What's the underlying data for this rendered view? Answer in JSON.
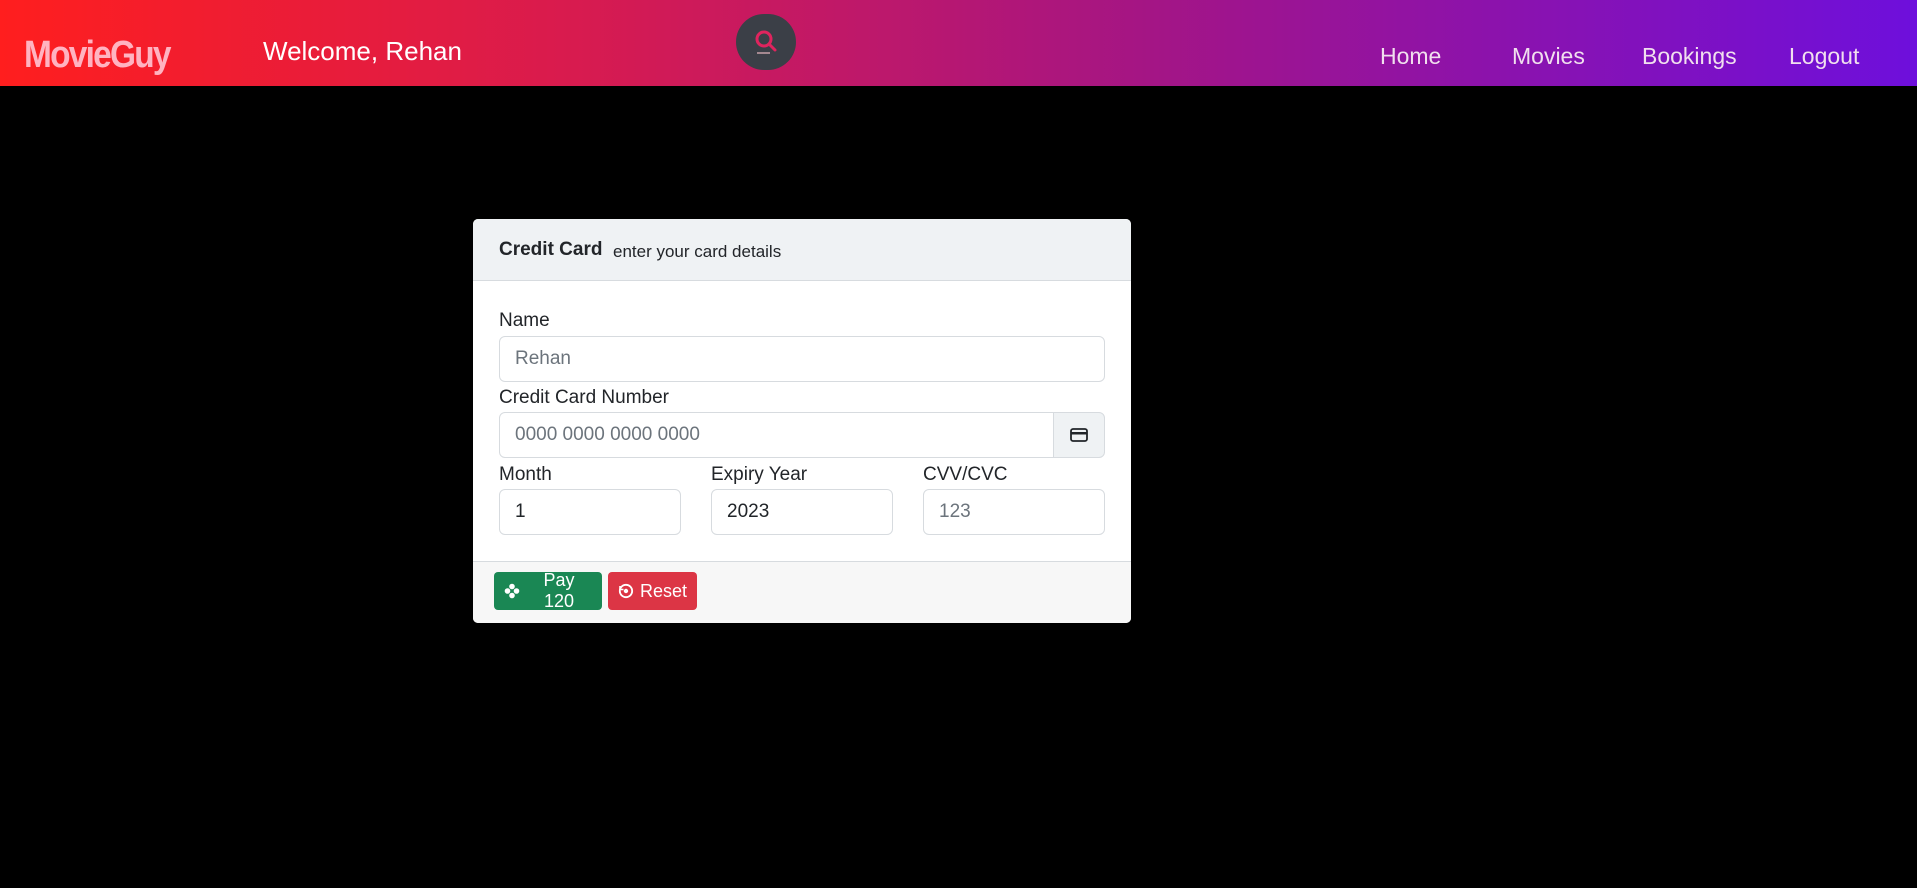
{
  "navbar": {
    "brand": "MovieGuy",
    "welcome_text": "Welcome, Rehan",
    "search_icon": "search-icon",
    "links": [
      {
        "label": "Home"
      },
      {
        "label": "Movies"
      },
      {
        "label": "Bookings"
      },
      {
        "label": "Logout"
      }
    ]
  },
  "card": {
    "title": "Credit Card",
    "subtitle": "enter your card details",
    "name": {
      "label": "Name",
      "placeholder": "Rehan"
    },
    "card_number": {
      "label": "Credit Card Number",
      "placeholder": "0000 0000 0000 0000",
      "addon_icon": "credit-card-icon"
    },
    "month": {
      "label": "Month",
      "value": "1"
    },
    "expiry_year": {
      "label": "Expiry Year",
      "value": "2023"
    },
    "cvv": {
      "label": "CVV/CVC",
      "placeholder": "123"
    },
    "pay_button": {
      "label": "Pay 120",
      "icon": "pay-icon"
    },
    "reset_button": {
      "label": "Reset",
      "icon": "reset-icon"
    }
  },
  "colors": {
    "navbar_gradient_start": "#ff1e1e",
    "navbar_gradient_end": "#6e0fdc",
    "background": "#000000",
    "pay_green": "#1a8754",
    "reset_red": "#dc3545",
    "search_icon_red": "#e0245e"
  }
}
